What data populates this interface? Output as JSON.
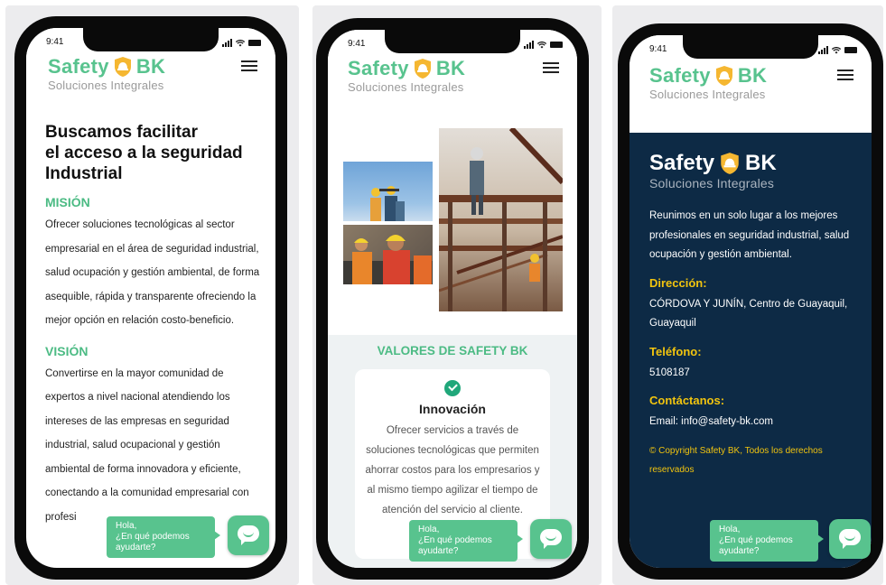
{
  "status_time": "9:41",
  "brand": {
    "name_left": "Safety",
    "name_right": "BK",
    "tagline": "Soluciones Integrales",
    "green": "#58c38e",
    "navy": "#0d2a45",
    "yellow": "#f1c40f",
    "shield_color": "#f5b731"
  },
  "screen1": {
    "heading": [
      "Buscamos facilitar",
      "el acceso a la seguridad",
      "Industrial"
    ],
    "mision_title": "MISIÓN",
    "mision_text": "Ofrecer soluciones tecnológicas al sector empresarial en el área de seguridad industrial, salud ocupación y gestión ambiental, de forma asequible, rápida y transparente ofreciendo la mejor opción en relación costo-beneficio.",
    "vision_title": "VISIÓN",
    "vision_text": "Convertirse en la mayor comunidad de expertos a nivel nacional atendiendo los intereses de las empresas en seguridad industrial, salud ocupacional y gestión ambiental de forma innovadora y eficiente, conectando a la comunidad empresarial con profesi"
  },
  "screen2": {
    "values_title": "VALORES DE SAFETY BK",
    "card_title": "Innovación",
    "card_text": "Ofrecer servicios a través de soluciones tecnológicas que permiten ahorrar costos para los empresarios y al mismo tiempo agilizar el tiempo de atención del servicio al cliente."
  },
  "screen3": {
    "intro": "Reunimos en un solo lugar a los mejores profesionales en seguridad industrial, salud ocupación y gestión ambiental.",
    "address_title": "Dirección:",
    "address_text": "CÓRDOVA Y JUNÍN, Centro de Guayaquil, Guayaquil",
    "phone_title": "Teléfono:",
    "phone_text": "5108187",
    "contact_title": "Contáctanos:",
    "contact_text": "Email: info@safety-bk.com",
    "copyright": "© Copyright Safety BK, Todos los derechos reservados"
  },
  "chat": {
    "line1": "Hola,",
    "line2": "¿En qué podemos",
    "line3": "ayudarte?"
  }
}
